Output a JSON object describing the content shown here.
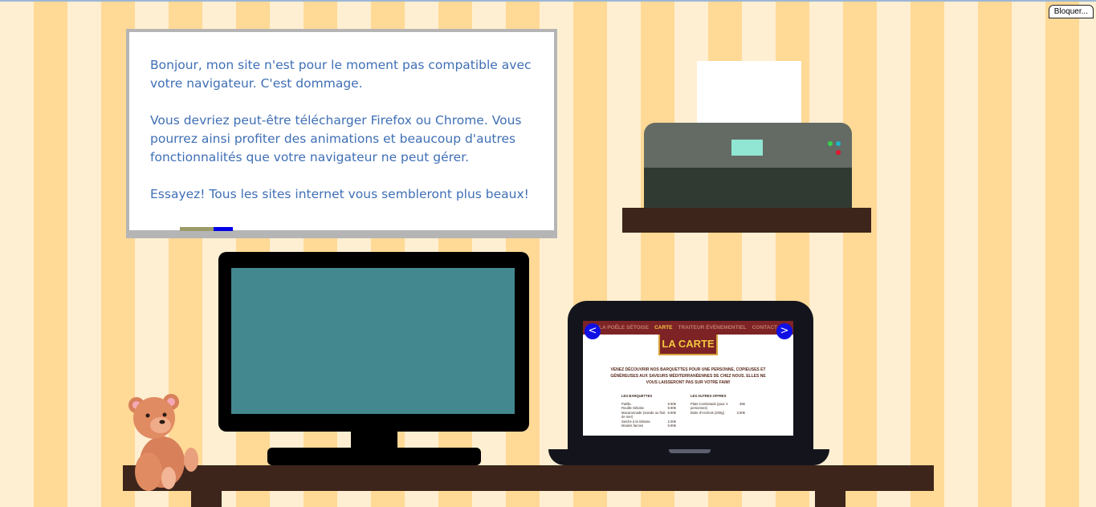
{
  "toolbar": {
    "block_button_label": "Bloquer..."
  },
  "whiteboard": {
    "paragraphs": [
      "Bonjour, mon site n'est pour le moment pas compatible avec votre navigateur. C'est dommage.",
      "Vous devriez peut-être télécharger Firefox ou Chrome. Vous pourrez ainsi profiter des animations et beaucoup d'autres fonctionnalités que votre navigateur ne peut gérer.",
      "Essayez! Tous les sites internet vous sembleront plus beaux!"
    ],
    "text_color": "#3f6fb5"
  },
  "laptop_site": {
    "nav": [
      "LA POÊLE SÉTOISE",
      "CARTE",
      "TRAITEUR ÉVÉNEMENTIEL",
      "CONTACT"
    ],
    "active_nav": "CARTE",
    "title": "LA CARTE",
    "intro": "VENEZ DÉCOUVRIR NOS BARQUETTES POUR UNE PERSONNE, COPIEUSES ET GÉNÉREUSES AUX SAVEURS MÉDITERRANÉENNES DE CHEZ NOUS. ELLES NE VOUS LAISSERONT PAS SUR VOTRE FAIM!",
    "columns": [
      {
        "heading": "LES BARQUETTES",
        "items": [
          {
            "name": "Paëlla",
            "price": "9.90€"
          },
          {
            "name": "Rouille Sétoise",
            "price": "9.90€"
          },
          {
            "name": "Macaronnade (viande ou fruit de mer)",
            "price": "6.90€"
          },
          {
            "name": "Seiche à la Sétoise",
            "price": "2.00€"
          },
          {
            "name": "Moules farcies",
            "price": "9.90€"
          }
        ]
      },
      {
        "heading": "LES AUTRES OFFRES",
        "items": [
          {
            "name": "Plats Combinado (pour 4 personnes)",
            "price": "35€"
          },
          {
            "name": "Boite d'Anchois (200g)",
            "price": "3.60€"
          }
        ]
      }
    ],
    "prev_label": "<",
    "next_label": ">"
  },
  "colors": {
    "stripe_light": "#ffefd2",
    "stripe_dark": "#ffd996",
    "monitor_screen": "#42888e",
    "furniture": "#3d251b",
    "printer_screen": "#91e6d3"
  }
}
